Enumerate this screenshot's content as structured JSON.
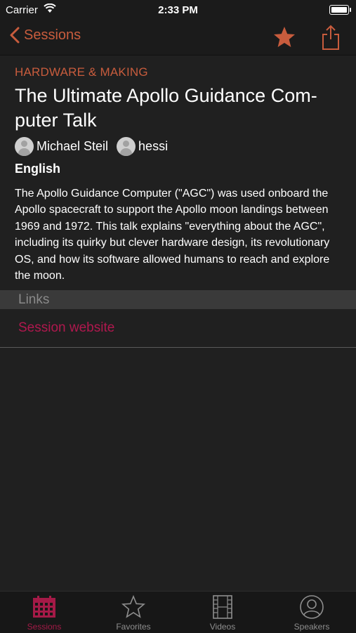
{
  "status_bar": {
    "carrier": "Carrier",
    "time": "2:33 PM"
  },
  "nav": {
    "back_label": "Sessions"
  },
  "session": {
    "track": "HARDWARE & MAKING",
    "title": "The Ultimate Apollo Guidance Com-puter Talk",
    "speakers": [
      "Michael Steil",
      "hessi"
    ],
    "language": "English",
    "abstract": "The Apollo Guidance Computer (\"AGC\") was used onboard the Apollo spacecraft to support the Apollo moon landings between 1969 and 1972. This talk explains \"everything about the AGC\", including its quirky but clever hardware design, its revolutionary OS, and how its software allowed humans to reach and explore the moon."
  },
  "links": {
    "header": "Links",
    "items": [
      "Session website"
    ]
  },
  "tabs": [
    {
      "label": "Sessions",
      "icon": "calendar-icon",
      "active": true
    },
    {
      "label": "Favorites",
      "icon": "star-outline-icon",
      "active": false
    },
    {
      "label": "Videos",
      "icon": "film-icon",
      "active": false
    },
    {
      "label": "Speakers",
      "icon": "person-icon",
      "active": false
    }
  ],
  "colors": {
    "accent": "#c85c3d",
    "link": "#b0184e",
    "tab_active": "#a41a47",
    "background": "#202020"
  }
}
